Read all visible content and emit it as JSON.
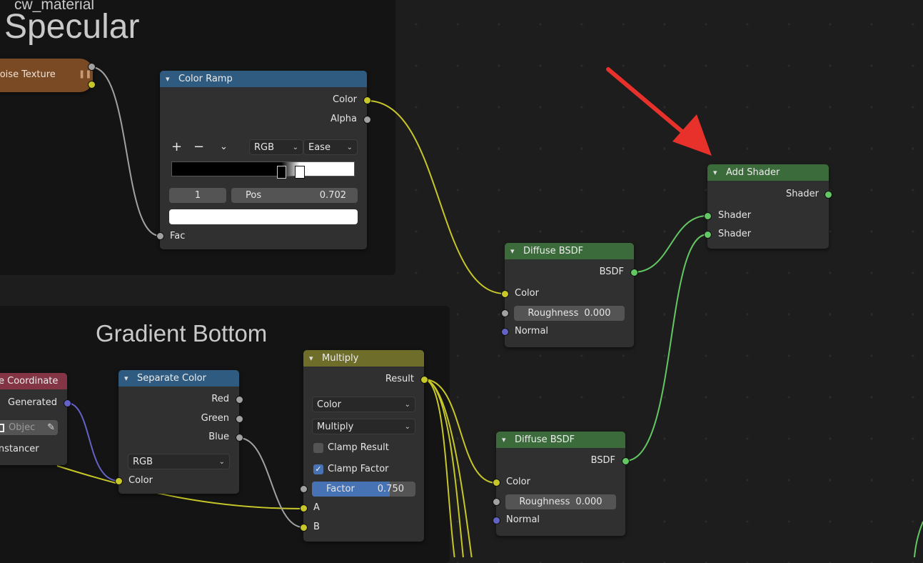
{
  "material_name": "cw_material",
  "frames": {
    "specular": "Specular",
    "gradient_bottom": "Gradient Bottom"
  },
  "nodes": {
    "noise_texture": {
      "title": "Noise Texture",
      "color": "#7a4a24"
    },
    "color_ramp": {
      "title": "Color Ramp",
      "outputs": [
        "Color",
        "Alpha"
      ],
      "add_label": "+",
      "remove_label": "−",
      "color_mode": "RGB",
      "interpolation": "Ease",
      "stop_index": "1",
      "pos_label": "Pos",
      "pos_value": "0.702",
      "input": "Fac",
      "header_color": "#2f5b80"
    },
    "diffuse_top": {
      "title": "Diffuse BSDF",
      "output": "BSDF",
      "color_input": "Color",
      "roughness_label": "Roughness",
      "roughness_value": "0.000",
      "normal_input": "Normal"
    },
    "diffuse_bottom": {
      "title": "Diffuse BSDF",
      "output": "BSDF",
      "color_input": "Color",
      "roughness_label": "Roughness",
      "roughness_value": "0.000",
      "normal_input": "Normal"
    },
    "add_shader": {
      "title": "Add Shader",
      "output": "Shader",
      "inputs": [
        "Shader",
        "Shader"
      ]
    },
    "texture_coordinate": {
      "title": "e Coordinate",
      "output_generated": "Generated",
      "object_placeholder": "Objec",
      "instancer": "Instancer"
    },
    "separate_color": {
      "title": "Separate Color",
      "outputs": [
        "Red",
        "Green",
        "Blue"
      ],
      "mode": "RGB",
      "input": "Color"
    },
    "multiply": {
      "title": "Multiply",
      "output": "Result",
      "data_type": "Color",
      "blend_mode": "Multiply",
      "clamp_result_label": "Clamp Result",
      "clamp_result": false,
      "clamp_factor_label": "Clamp Factor",
      "clamp_factor": true,
      "factor_label": "Factor",
      "factor_value": "0.750",
      "factor": 0.75,
      "input_a": "A",
      "input_b": "B"
    }
  },
  "colors": {
    "shader_header": "#3b6b3b",
    "converter_header": "#2f5b80",
    "color_header": "#6e6e2a",
    "input_header": "#833545",
    "link_yellow": "#c7c729",
    "link_green": "#63c763",
    "link_gray": "#a1a1a1",
    "link_purple": "#6363c7",
    "annotation_arrow": "#e8312b"
  }
}
